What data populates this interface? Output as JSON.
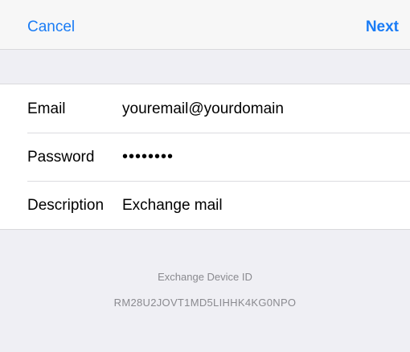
{
  "navbar": {
    "cancel_label": "Cancel",
    "next_label": "Next"
  },
  "form": {
    "email": {
      "label": "Email",
      "value": "youremail@yourdomain"
    },
    "password": {
      "label": "Password",
      "value": "••••••••"
    },
    "description": {
      "label": "Description",
      "value": "Exchange mail"
    }
  },
  "footer": {
    "title": "Exchange Device ID",
    "device_id": "RM28U2JOVT1MD5LIHHK4KG0NPO"
  },
  "colors": {
    "accent": "#1a7cf5",
    "background": "#efeff4",
    "secondary_text": "#8a8a8f"
  }
}
